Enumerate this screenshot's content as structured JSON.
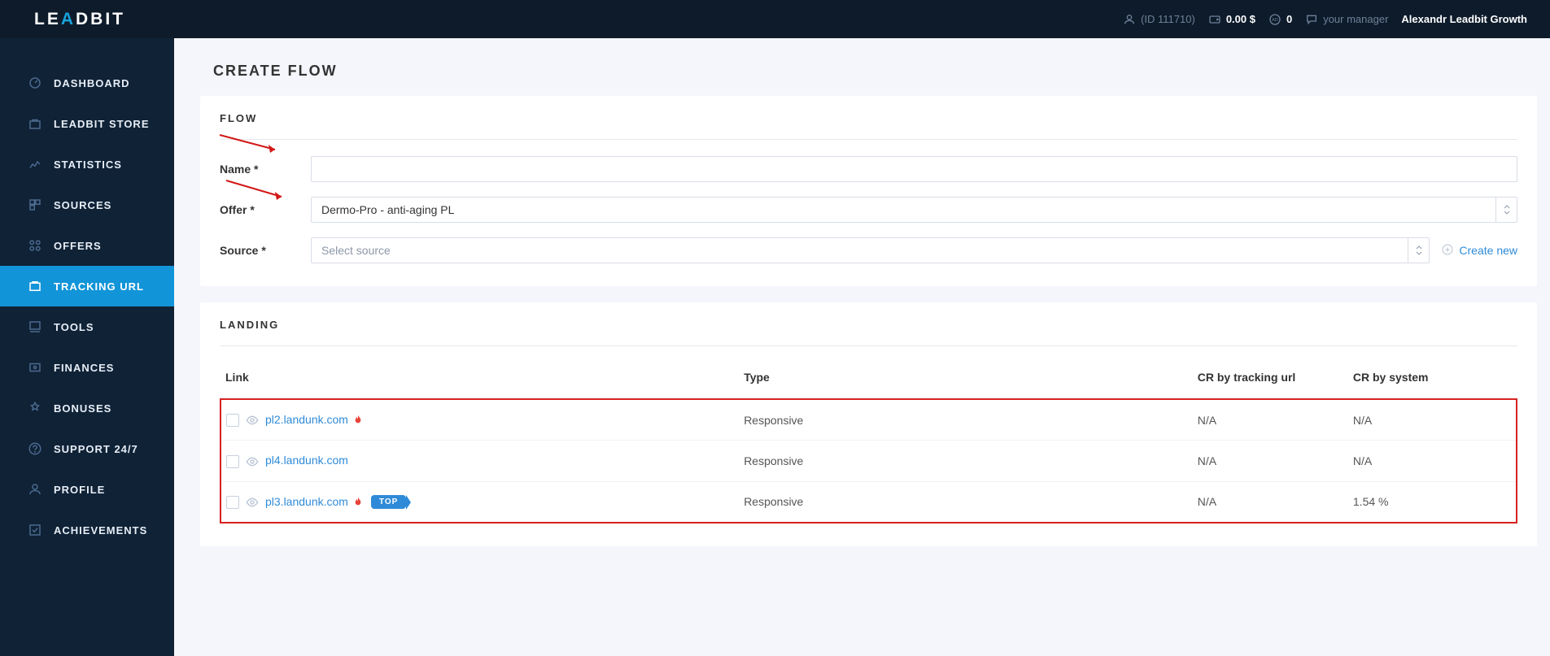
{
  "brand": {
    "lead": "LE",
    "triangle": "A",
    "dbit": "DBIT"
  },
  "header": {
    "user_id": "(ID 111710)",
    "balance": "0.00 $",
    "ad_count": "0",
    "manager_label": "your manager",
    "manager_name": "Alexandr Leadbit Growth"
  },
  "sidebar": {
    "items": [
      {
        "label": "DASHBOARD"
      },
      {
        "label": "LEADBIT STORE"
      },
      {
        "label": "STATISTICS"
      },
      {
        "label": "SOURCES"
      },
      {
        "label": "OFFERS"
      },
      {
        "label": "TRACKING URL"
      },
      {
        "label": "TOOLS"
      },
      {
        "label": "FINANCES"
      },
      {
        "label": "BONUSES"
      },
      {
        "label": "SUPPORT 24/7"
      },
      {
        "label": "PROFILE"
      },
      {
        "label": "ACHIEVEMENTS"
      }
    ]
  },
  "page": {
    "title": "CREATE FLOW"
  },
  "flow": {
    "section_title": "FLOW",
    "name_label": "Name *",
    "name_value": "",
    "offer_label": "Offer *",
    "offer_value": "Dermo-Pro - anti-aging PL",
    "source_label": "Source *",
    "source_placeholder": "Select source",
    "create_new": "Create new"
  },
  "landing": {
    "section_title": "LANDING",
    "headers": {
      "link": "Link",
      "type": "Type",
      "cr_track": "CR by tracking url",
      "cr_sys": "CR by system"
    },
    "rows": [
      {
        "link": "pl2.landunk.com",
        "flame": true,
        "top": false,
        "type": "Responsive",
        "cr_track": "N/A",
        "cr_sys": "N/A"
      },
      {
        "link": "pl4.landunk.com",
        "flame": false,
        "top": false,
        "type": "Responsive",
        "cr_track": "N/A",
        "cr_sys": "N/A"
      },
      {
        "link": "pl3.landunk.com",
        "flame": true,
        "top": true,
        "type": "Responsive",
        "cr_track": "N/A",
        "cr_sys": "1.54 %"
      }
    ],
    "top_badge": "TOP"
  }
}
